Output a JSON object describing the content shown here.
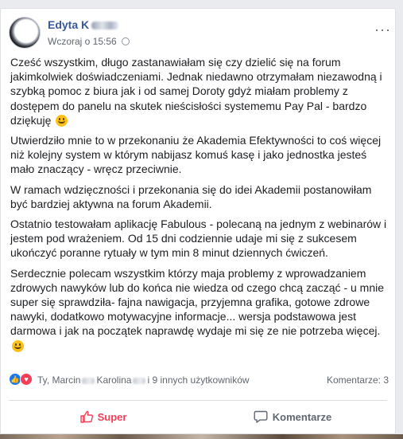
{
  "post": {
    "author": "Edyta K",
    "timestamp": "Wczoraj o 15:56",
    "more_label": "···",
    "paragraphs": [
      "Cześć wszystkim, długo zastanawiałam się czy dzielić się na forum jakimkolwiek doświadczeniami. Jednak niedawno otrzymałam niezawodną i szybką pomoc z biura jak i od samej Doroty gdyż miałam problemy z dostępem do panelu na skutek nieścisłości systememu Pay Pal - bardzo dziękuję",
      "Utwierdziło mnie to w przekonaniu że Akademia Efektywności to coś więcej niż kolejny system w którym nabijasz komuś kasę i jako jednostka jesteś mało znaczący - wręcz przeciwnie.",
      "W ramach wdzięczności i przekonania się do idei Akademii postanowiłam być bardziej aktywna na forum Akademii.",
      "Ostatnio testowałam aplikację Fabulous - polecaną na jednym z webinarów i jestem pod wrażeniem. Od 15 dni codziennie udaje mi się z sukcesem ukończyć poranne rytuały w tym min 8 minut dziennych ćwiczeń.",
      "Serdecznie polecam wszystkim którzy maja problemy z wprowadzaniem zdrowych nawyków lub do końca nie wiedza od czego chcą zacząć - u mnie super się sprawdziła- fajna nawigacja, przyjemna grafika, gotowe zdrowe nawyki, dodatkowo motywacyjne informacje... wersja podstawowa jest darmowa i jak na początek naprawdę wydaje mi się ze nie potrzeba więcej."
    ]
  },
  "reactions": {
    "reactors_part1": "Ty, Marcin",
    "reactors_part2": "Karolina",
    "reactors_part3": "i 9 innych użytkowników",
    "comments": "Komentarze: 3"
  },
  "actions": {
    "like_label": "Super",
    "comment_label": "Komentarze"
  },
  "icons": {
    "like": "thumbs-up-icon",
    "love": "heart-icon",
    "emoji": "smiley-icon",
    "audience": "globe-icon",
    "comment": "speech-bubble-icon"
  },
  "colors": {
    "author_link": "#385898",
    "like_active": "#f33e58",
    "like_reaction": "#1877f2",
    "text": "#1c1e21",
    "meta": "#606770"
  }
}
